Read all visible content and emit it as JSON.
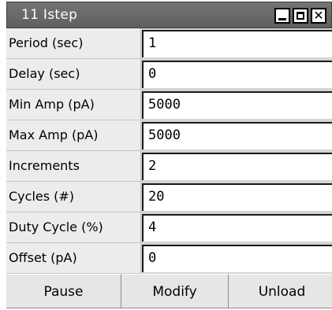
{
  "window": {
    "title": "11 Istep"
  },
  "params": [
    {
      "label": "Period (sec)",
      "value": "1"
    },
    {
      "label": "Delay (sec)",
      "value": "0"
    },
    {
      "label": "Min Amp (pA)",
      "value": "5000"
    },
    {
      "label": "Max Amp (pA)",
      "value": "5000"
    },
    {
      "label": "Increments",
      "value": "2"
    },
    {
      "label": "Cycles (#)",
      "value": "20"
    },
    {
      "label": "Duty Cycle (%)",
      "value": "4"
    },
    {
      "label": "Offset (pA)",
      "value": "0"
    }
  ],
  "buttons": {
    "pause": "Pause",
    "modify": "Modify",
    "unload": "Unload"
  }
}
